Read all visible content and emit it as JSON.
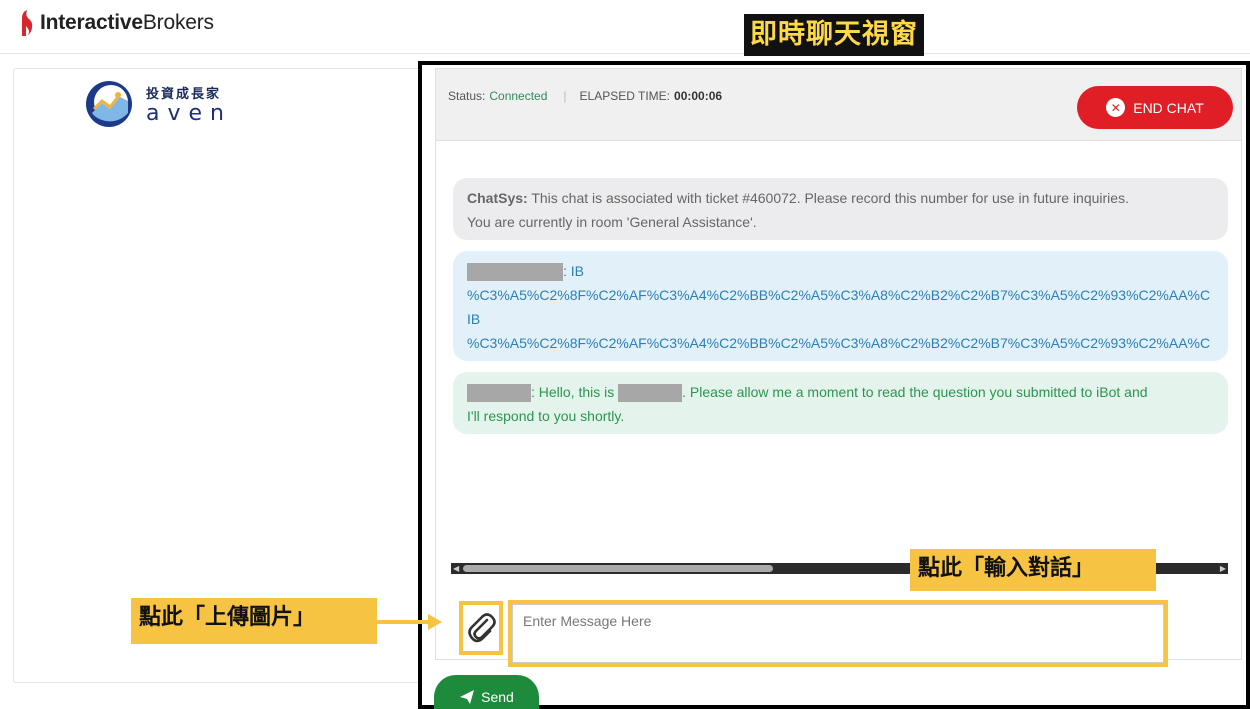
{
  "brand": {
    "name_bold": "Interactive",
    "name_regular": "Brokers"
  },
  "left_logo": {
    "chinese": "投資成長家",
    "english": "aven"
  },
  "annotations": {
    "chat_window": "即時聊天視窗",
    "input_hint": "點此「輸入對話」",
    "upload_hint": "點此「上傳圖片」"
  },
  "status_bar": {
    "status_label": "Status:",
    "status_value": "Connected",
    "separator": "|",
    "elapsed_label": "ELAPSED TIME:",
    "elapsed_value": "00:00:06",
    "end_chat_label": "END CHAT"
  },
  "messages": {
    "system": {
      "sender": "ChatSys:",
      "line1": "This chat is associated with ticket #460072. Please record this number for use in future inquiries.",
      "line2": "You are currently in room 'General Assistance'."
    },
    "user": {
      "sep": ": IB",
      "line2": "%C3%A5%C2%8F%C2%AF%C3%A4%C2%BB%C2%A5%C3%A8%C2%B2%C2%B7%C3%A5%C2%93%C2%AA%C",
      "line3": "IB",
      "line4": "%C3%A5%C2%8F%C2%AF%C3%A4%C2%BB%C2%A5%C3%A8%C2%B2%C2%B7%C3%A5%C2%93%C2%AA%C"
    },
    "agent": {
      "part1": ": Hello, this is ",
      "part2": ". Please allow me a moment to read the question you submitted to iBot and",
      "line2": "I'll respond to you shortly."
    }
  },
  "composer": {
    "placeholder": "Enter Message Here",
    "send_label": "Send"
  },
  "colors": {
    "end_chat": "#e01e26",
    "send": "#1e8a3c",
    "connected": "#2e8b57",
    "annotation": "#f6c343"
  }
}
